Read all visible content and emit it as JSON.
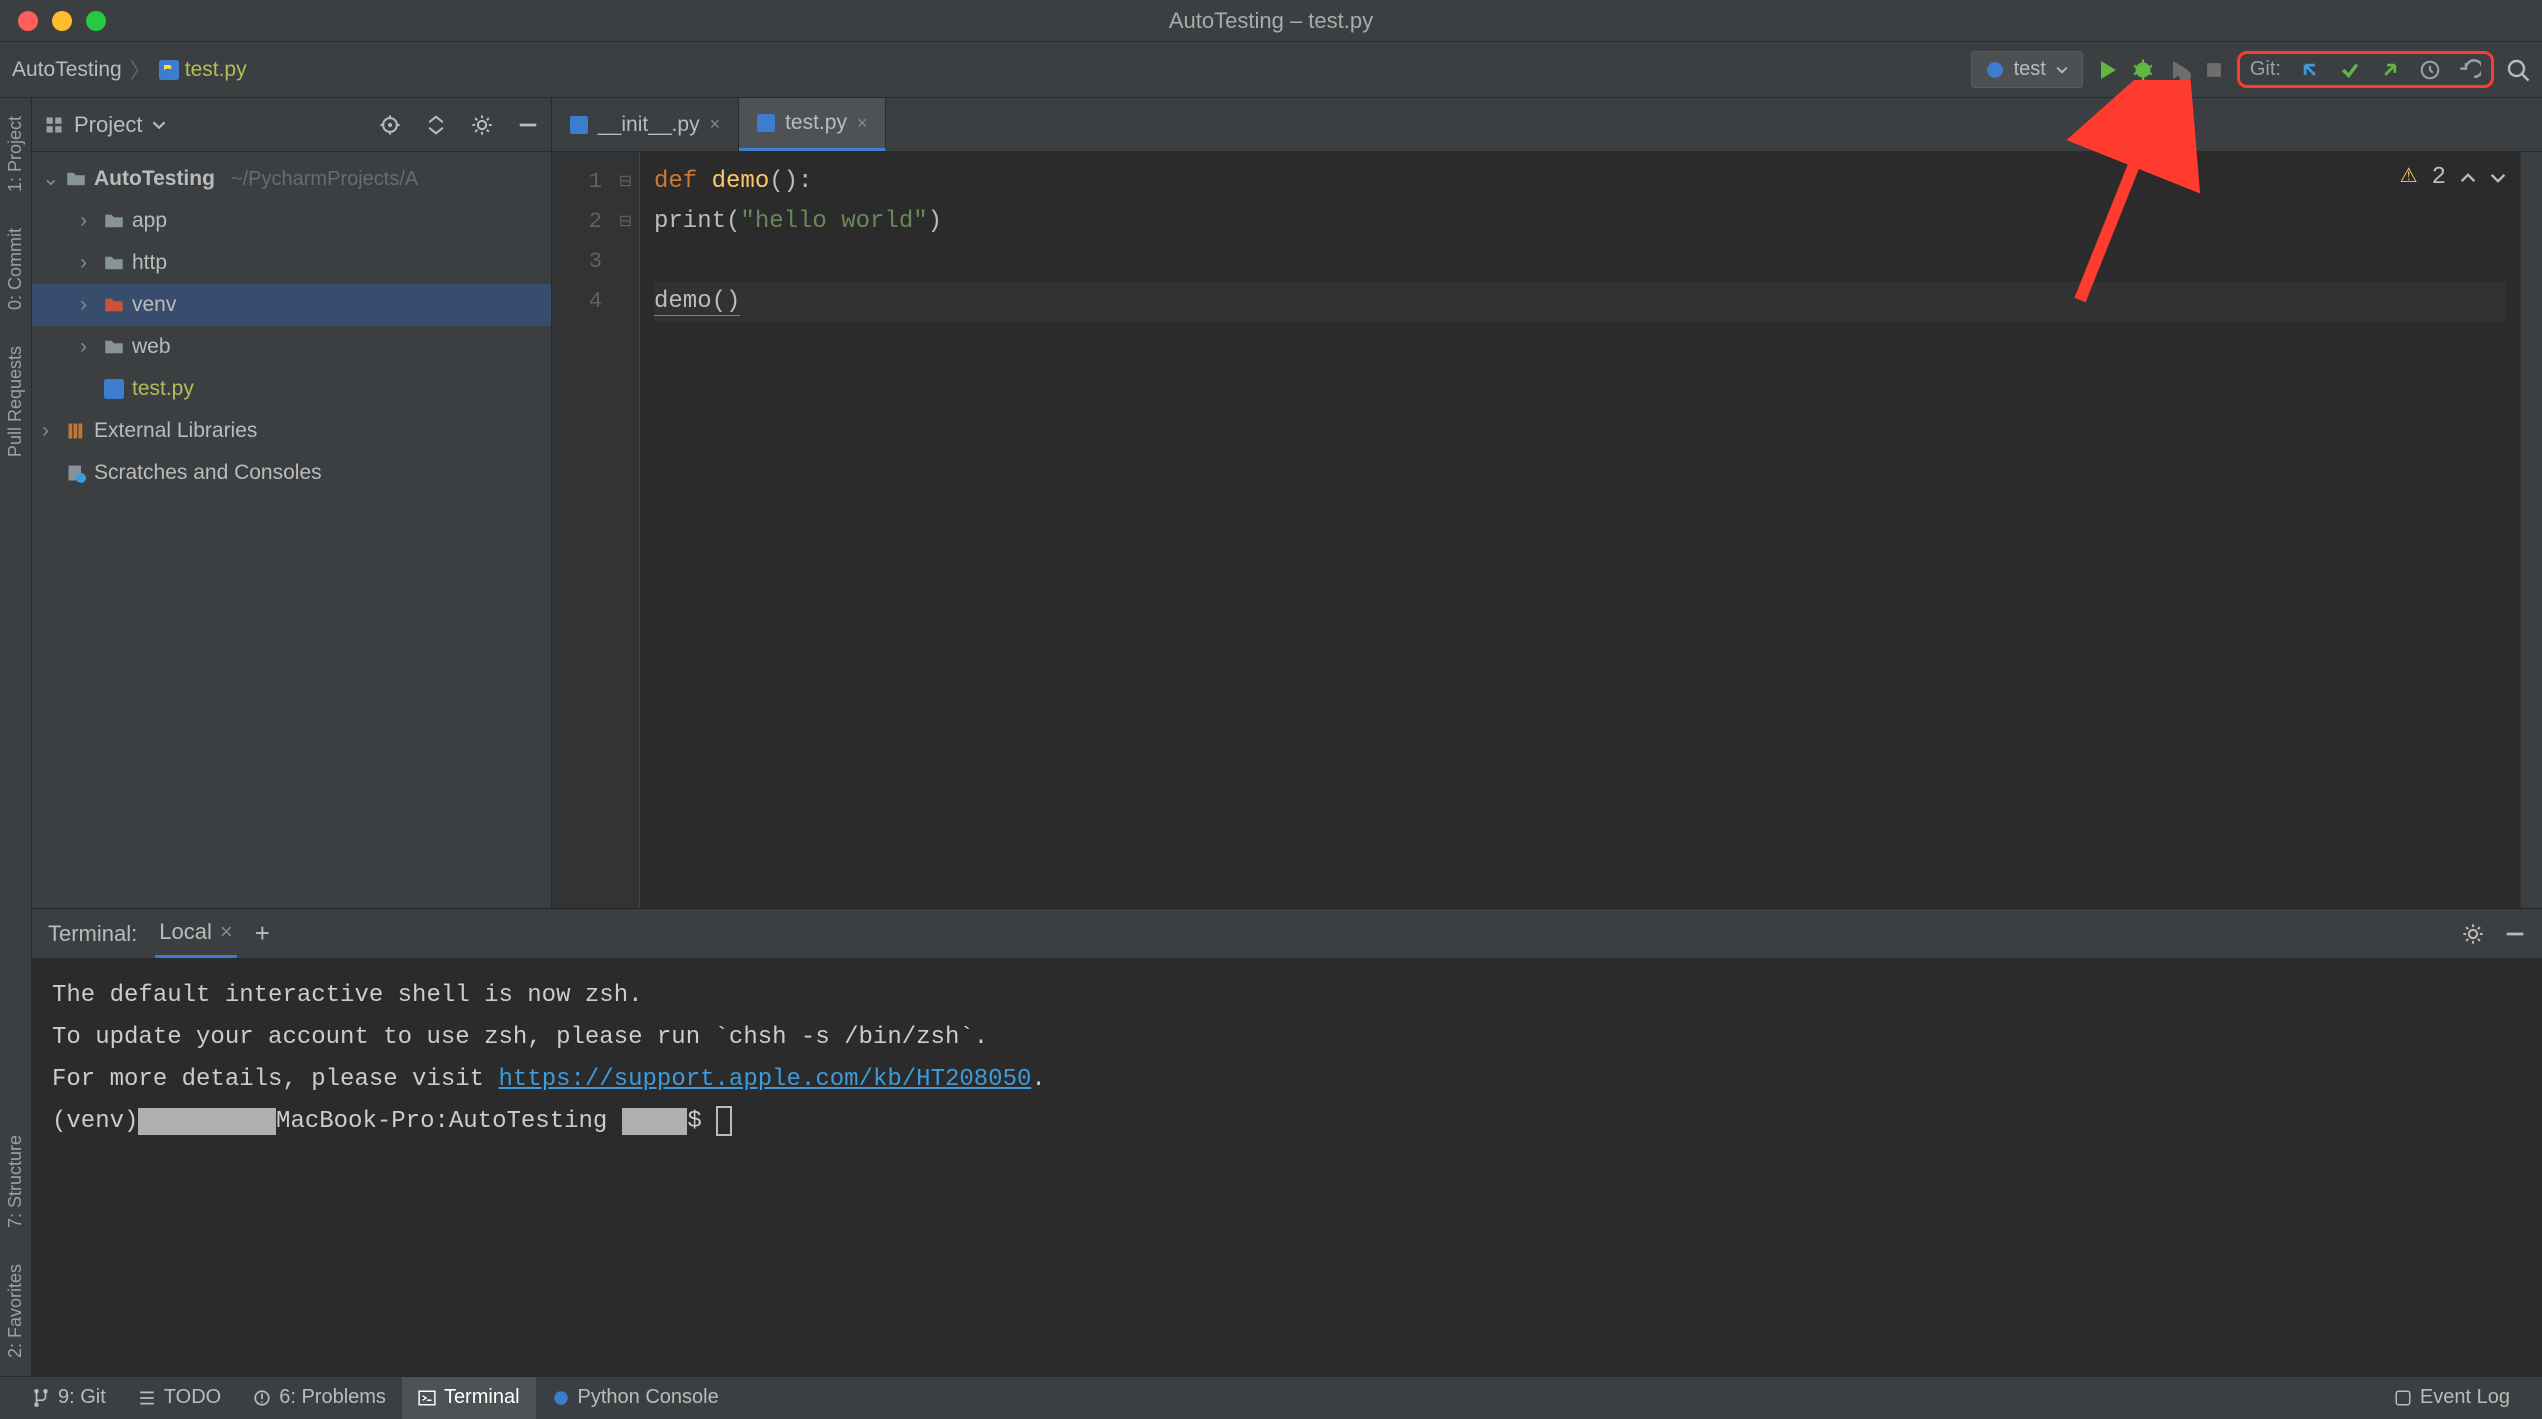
{
  "window": {
    "title": "AutoTesting – test.py"
  },
  "breadcrumbs": {
    "project": "AutoTesting",
    "file": "test.py"
  },
  "run_config": {
    "name": "test"
  },
  "git": {
    "label": "Git:"
  },
  "project_tool": {
    "title": "Project",
    "root": "AutoTesting",
    "root_path": "~/PycharmProjects/A",
    "folders": {
      "app": "app",
      "http": "http",
      "venv": "venv",
      "web": "web"
    },
    "root_file": "test.py",
    "external": "External Libraries",
    "scratches": "Scratches and Consoles"
  },
  "left_tabs": {
    "project": "1: Project",
    "commit": "0: Commit",
    "pull": "Pull Requests",
    "structure": "7: Structure",
    "favorites": "2: Favorites"
  },
  "editor": {
    "tabs": {
      "init": "__init__.py",
      "test": "test.py"
    },
    "lines": [
      "1",
      "2",
      "3",
      "4"
    ],
    "code": {
      "l1a": "def ",
      "l1b": "demo",
      "l1c": "():",
      "l2a": "    print(",
      "l2b": "\"hello world\"",
      "l2c": ")",
      "l4": "demo()"
    },
    "warnings": "2"
  },
  "terminal": {
    "title": "Terminal:",
    "tab_local": "Local",
    "line1": "The default interactive shell is now zsh.",
    "line2": "To update your account to use zsh, please run `chsh -s /bin/zsh`.",
    "line3a": "For more details, please visit ",
    "line3b": "https://support.apple.com/kb/HT208050",
    "line3c": ".",
    "prompt_a": "(venv)",
    "prompt_b": "MacBook-Pro:AutoTesting ",
    "prompt_c": "$ "
  },
  "statusbar": {
    "git": "9: Git",
    "todo": "TODO",
    "problems": "6: Problems",
    "terminal": "Terminal",
    "pyconsole": "Python Console",
    "eventlog": "Event Log"
  }
}
